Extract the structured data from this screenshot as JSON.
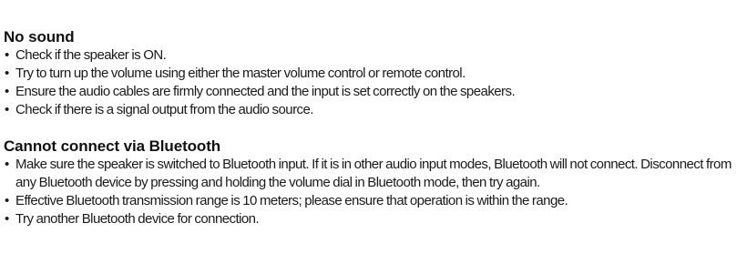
{
  "sections": [
    {
      "title": "No sound",
      "items": [
        "Check if the speaker is ON.",
        "Try to turn up the volume using either the master volume control or remote control.",
        "Ensure the audio cables are firmly connected and the input is set correctly on the speakers.",
        "Check if there is a signal output from the audio source."
      ]
    },
    {
      "title": "Cannot connect via Bluetooth",
      "items": [
        "Make sure the speaker is switched to Bluetooth input. If it is in other audio input modes, Bluetooth will not connect. Disconnect from any Bluetooth device by pressing and holding the volume dial in Bluetooth mode, then try again.",
        "Effective Bluetooth transmission range is 10 meters; please ensure that operation is within the range.",
        "Try another Bluetooth device for connection."
      ]
    }
  ],
  "bullet_glyph": "•"
}
